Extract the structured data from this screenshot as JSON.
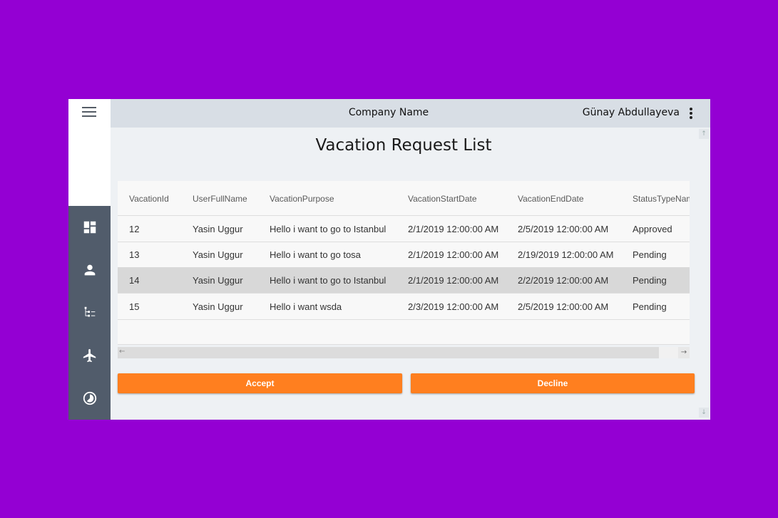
{
  "header": {
    "company_name": "Company Name",
    "user_name": "Günay Abdullayeva"
  },
  "sidebar": {
    "items": [
      {
        "icon": "dashboard-icon"
      },
      {
        "icon": "person-icon"
      },
      {
        "icon": "hierarchy-icon"
      },
      {
        "icon": "airplane-icon"
      },
      {
        "icon": "chart-icon"
      }
    ]
  },
  "page": {
    "title": "Vacation Request List"
  },
  "table": {
    "columns": [
      "VacationId",
      "UserFullName",
      "VacationPurpose",
      "VacationStartDate",
      "VacationEndDate",
      "StatusTypeName"
    ],
    "rows": [
      [
        "12",
        "Yasin Uggur",
        "Hello i want to go to Istanbul",
        "2/1/2019 12:00:00 AM",
        "2/5/2019 12:00:00 AM",
        "Approved"
      ],
      [
        "13",
        "Yasin Uggur",
        "Hello i want to go tosa",
        "2/1/2019 12:00:00 AM",
        "2/19/2019 12:00:00 AM",
        "Pending"
      ],
      [
        "14",
        "Yasin Uggur",
        "Hello i want to go to Istanbul",
        "2/1/2019 12:00:00 AM",
        "2/2/2019 12:00:00 AM",
        "Pending"
      ],
      [
        "15",
        "Yasin Uggur",
        "Hello i want wsda",
        "2/3/2019 12:00:00 AM",
        "2/5/2019 12:00:00 AM",
        "Pending"
      ]
    ],
    "selected_row": 2
  },
  "actions": {
    "accept_label": "Accept",
    "decline_label": "Decline"
  },
  "colors": {
    "background": "#9400d3",
    "sidebar": "#515c6b",
    "header": "#d8dee5",
    "accent": "#ff7f1f"
  }
}
